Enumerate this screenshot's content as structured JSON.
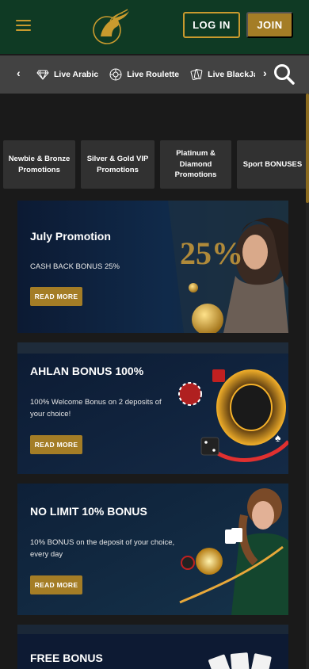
{
  "header": {
    "login_label": "LOG IN",
    "join_label": "JOIN",
    "colors": {
      "background": "#0f3a24",
      "accent": "#c99a2e",
      "join_bg": "#a47d26"
    }
  },
  "category_nav": {
    "items": [
      {
        "label": "Live Arabic",
        "icon": "diamond-icon"
      },
      {
        "label": "Live Roulette",
        "icon": "roulette-icon"
      },
      {
        "label": "Live BlackJac",
        "icon": "cards-icon"
      }
    ],
    "prev_arrow": "‹",
    "next_arrow": "›"
  },
  "promo_tabs": [
    {
      "label": "Newbie & Bronze Promotions"
    },
    {
      "label": "Silver & Gold VIP Promotions"
    },
    {
      "label": "Platinum & Diamond Promotions"
    },
    {
      "label": "Sport BONUSES"
    }
  ],
  "promotions": [
    {
      "title": "July Promotion",
      "description": "CASH BACK BONUS 25%",
      "button": "READ MORE",
      "badge": "25%"
    },
    {
      "title": "AHLAN BONUS 100%",
      "description": "100% Welcome Bonus on 2 deposits of your choice!",
      "button": "READ MORE"
    },
    {
      "title": "NO LIMIT 10% BONUS",
      "description": "10% BONUS on the deposit of your choice, every day",
      "button": "READ MORE"
    },
    {
      "title": "FREE BONUS"
    }
  ]
}
